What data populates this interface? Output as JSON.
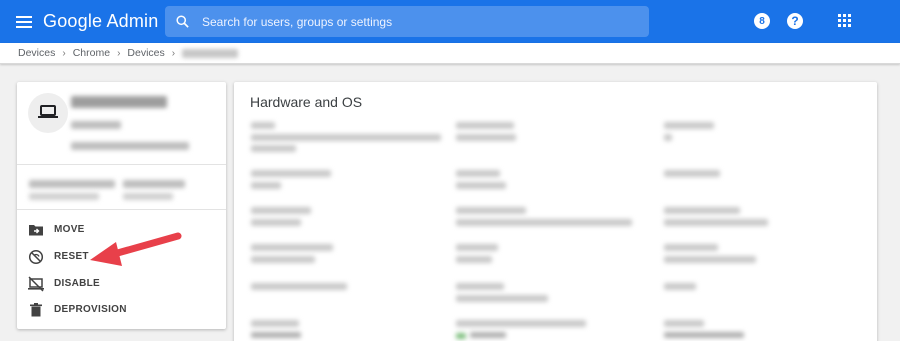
{
  "header": {
    "app_title": "Google Admin",
    "search_placeholder": "Search for users, groups or settings",
    "notification_count": "8",
    "help_label": "?"
  },
  "breadcrumb": [
    "Devices",
    "Chrome",
    "Devices"
  ],
  "device": {
    "actions": [
      {
        "label": "MOVE",
        "icon": "folder-move-icon"
      },
      {
        "label": "RESET",
        "icon": "reset-icon"
      },
      {
        "label": "DISABLE",
        "icon": "disable-icon"
      },
      {
        "label": "DEPROVISION",
        "icon": "trash-icon"
      }
    ]
  },
  "details": {
    "section_title": "Hardware and OS"
  },
  "colors": {
    "topbar": "#1a73e8",
    "arrow": "#e8404a"
  }
}
